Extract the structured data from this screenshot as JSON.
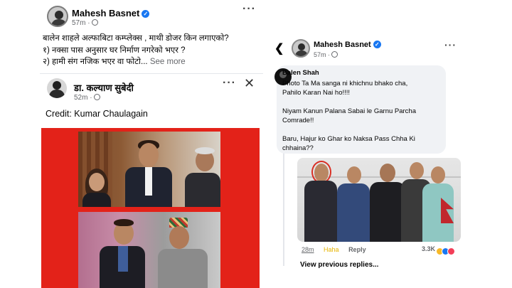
{
  "left_post": {
    "author": "Mahesh Basnet",
    "time": "57m ·",
    "text_lines": [
      "बालेन शाहले अल्फाबिटा कम्प्लेक्स , माथी डोजर किन लगाएको?",
      "१) नक्सा पास अनुसार घर निर्माण नगरेको भएर ?",
      "२) हामी संग नजिक भएर वा फोटो..."
    ],
    "see_more": "See more",
    "shared_author": "डा. कल्याण सुबेदी",
    "shared_time": "52m ·",
    "credit": "Credit: Kumar Chaulagain"
  },
  "right_post": {
    "author": "Mahesh Basnet",
    "time": "57m ·",
    "comment": {
      "author": "Balen Shah",
      "lines_1": [
        "Photo Ta Ma sanga ni khichnu bhako cha,",
        "Pahilo Karan Nai ho!!!!"
      ],
      "lines_2": [
        "Niyam Kanun Palana Sabai le Garnu Parcha",
        "Comrade!!"
      ],
      "lines_3": [
        "Baru, Hajur ko Ghar ko Naksa Pass Chha Ki",
        "chhaina??"
      ],
      "time": "28m",
      "haha": "Haha",
      "reply": "Reply",
      "reaction_count": "3.3K"
    },
    "view_previous": "View previous replies..."
  },
  "icons": {
    "verified": "verified-badge-icon",
    "globe": "globe-icon",
    "more": "more-dots-icon",
    "close": "close-icon",
    "back": "back-chevron-icon"
  },
  "colors": {
    "collage_red": "#e32219",
    "link_blue": "#1877f2",
    "haha_yellow": "#e7b400"
  }
}
